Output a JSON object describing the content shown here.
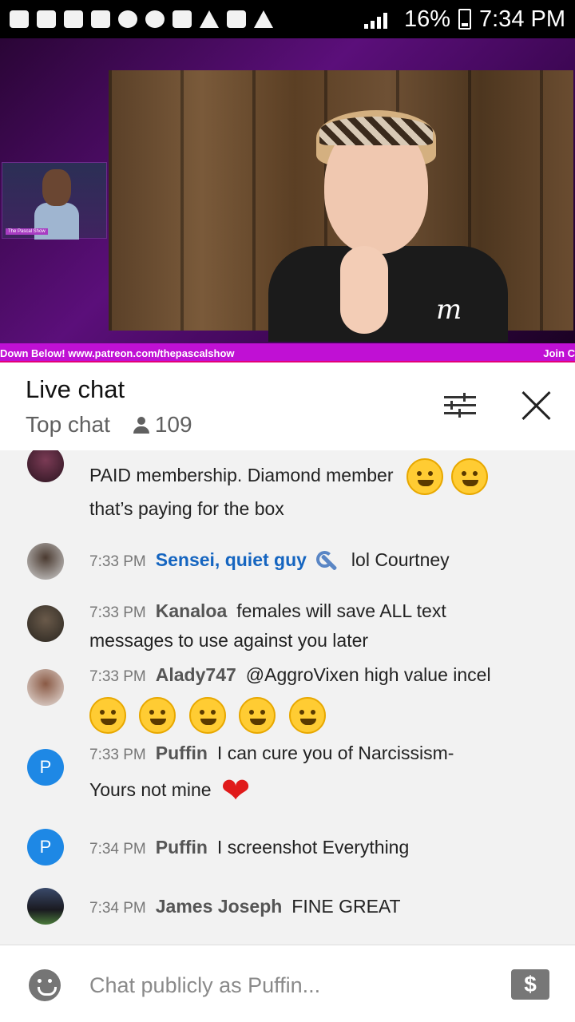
{
  "status_bar": {
    "battery": "16%",
    "time": "7:34 PM"
  },
  "video": {
    "ticker_left": "Down Below! www.patreon.com/thepascalshow",
    "ticker_right": "Join C",
    "inset_tag": "The Pascal Show",
    "shirt_logo": "m"
  },
  "chat_header": {
    "title": "Live chat",
    "mode": "Top chat",
    "viewer_count": "109"
  },
  "messages": [
    {
      "time": "",
      "author": "",
      "text": "PAID membership. Diamond member",
      "line2": "that’s paying for the box",
      "avatar": "avatar-icon",
      "emojis": [
        "woozy-face-icon",
        "laughing-tears-icon"
      ]
    },
    {
      "time": "7:33 PM",
      "author": "Sensei, quiet guy",
      "text": "lol Courtney",
      "moderator": true
    },
    {
      "time": "7:33 PM",
      "author": "Kanaloa",
      "text": "females will save ALL text messages to use against you later"
    },
    {
      "time": "7:33 PM",
      "author": "Alady747",
      "text": "@AggroVixen high value incel",
      "emojis": [
        "rofl-icon",
        "rofl-icon",
        "rofl-icon",
        "rofl-icon",
        "rofl-icon"
      ]
    },
    {
      "time": "7:33 PM",
      "author": "Puffin",
      "avatar_letter": "P",
      "text": "I can cure you of Narcissism-",
      "line2": "Yours not mine"
    },
    {
      "time": "7:34 PM",
      "author": "Puffin",
      "avatar_letter": "P",
      "text": "I screenshot Everything"
    },
    {
      "time": "7:34 PM",
      "author": "James Joseph",
      "text": "FINE GREAT"
    }
  ],
  "input": {
    "placeholder": "Chat publicly as Puffin...",
    "superchat_symbol": "$"
  },
  "colors": {
    "accent_blue": "#1e88e5",
    "moderator_blue": "#1565c0",
    "ticker_magenta": "#c010d4",
    "heart_red": "#e01a1a"
  }
}
